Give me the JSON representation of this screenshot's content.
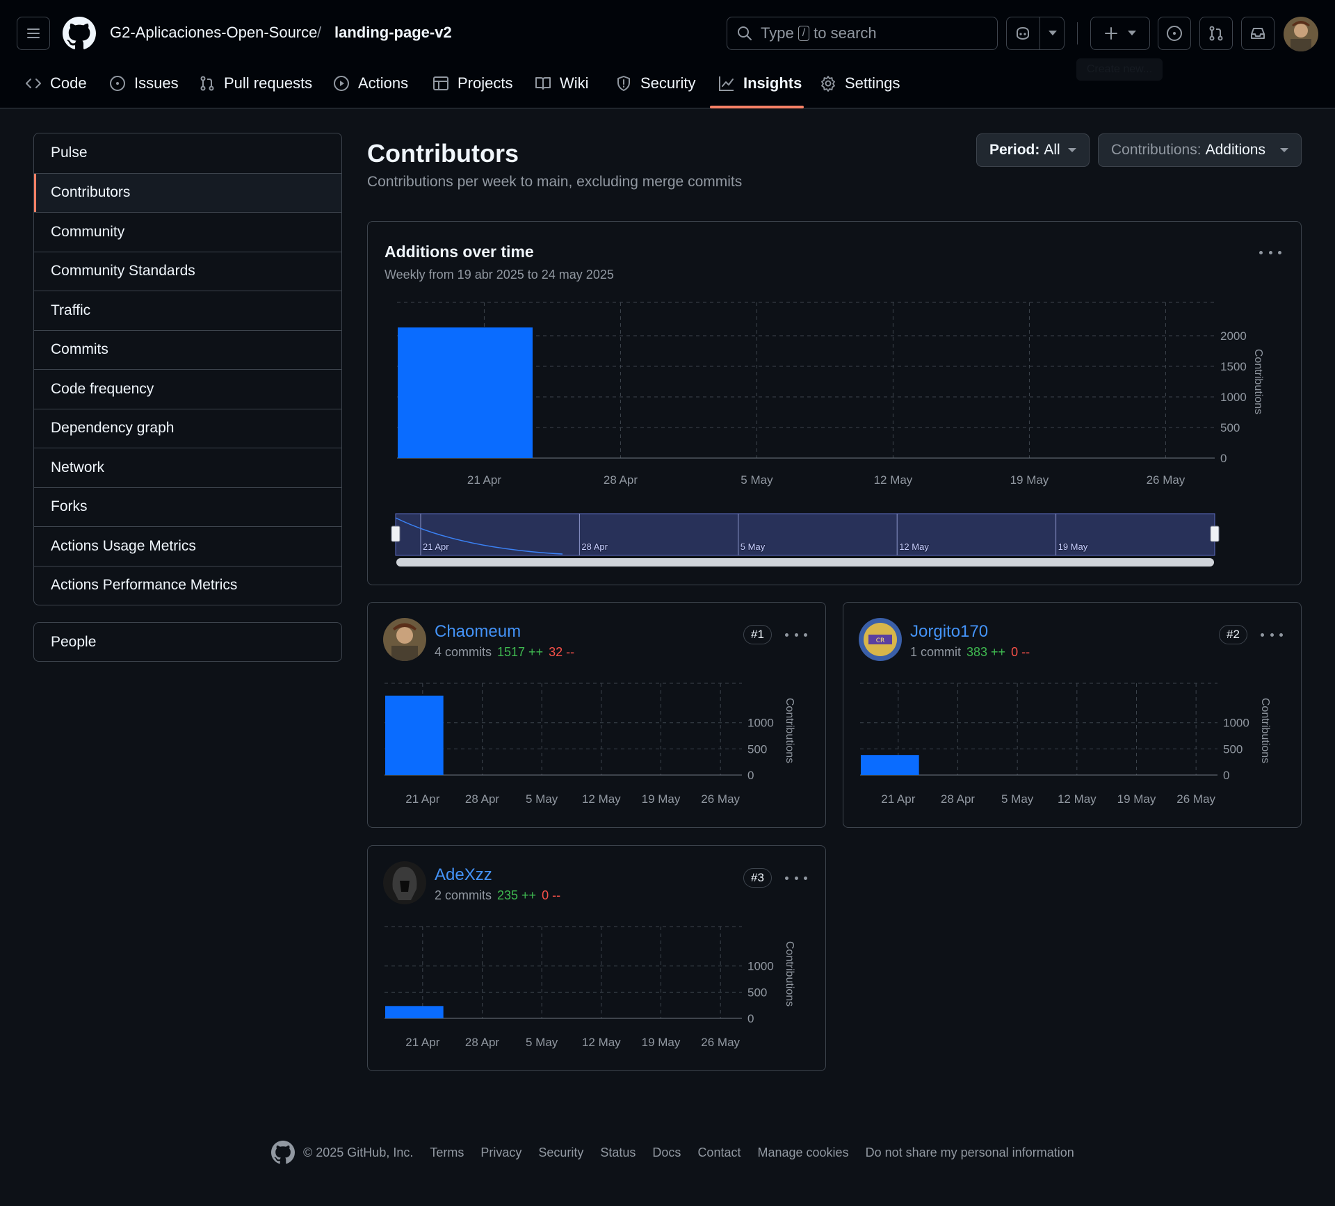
{
  "header": {
    "org": "G2-Aplicaciones-Open-Source",
    "separator": "/",
    "repo": "landing-page-v2",
    "search_prefix": "Type",
    "search_key": "/",
    "search_suffix": "to search",
    "tooltip": "Create new..."
  },
  "tabs": [
    {
      "label": "Code",
      "icon": "code-icon"
    },
    {
      "label": "Issues",
      "icon": "issue-icon"
    },
    {
      "label": "Pull requests",
      "icon": "pull-request-icon"
    },
    {
      "label": "Actions",
      "icon": "play-icon"
    },
    {
      "label": "Projects",
      "icon": "table-icon"
    },
    {
      "label": "Wiki",
      "icon": "book-icon"
    },
    {
      "label": "Security",
      "icon": "shield-icon"
    },
    {
      "label": "Insights",
      "icon": "graph-icon",
      "active": true
    },
    {
      "label": "Settings",
      "icon": "gear-icon"
    }
  ],
  "sidebar": {
    "items": [
      "Pulse",
      "Contributors",
      "Community",
      "Community Standards",
      "Traffic",
      "Commits",
      "Code frequency",
      "Dependency graph",
      "Network",
      "Forks",
      "Actions Usage Metrics",
      "Actions Performance Metrics"
    ],
    "selected": "Contributors",
    "people": "People"
  },
  "page": {
    "title": "Contributors",
    "subtitle": "Contributions per week to main, excluding merge commits",
    "period_label": "Period:",
    "period_value": "All",
    "contrib_label": "Contributions:",
    "contrib_value": "Additions"
  },
  "main_chart": {
    "title": "Additions over time",
    "subtitle": "Weekly from 19 abr 2025 to 24 may 2025"
  },
  "chart_data": [
    {
      "type": "bar",
      "title": "Additions over time",
      "categories": [
        "21 Apr",
        "28 Apr",
        "5 May",
        "12 May",
        "19 May",
        "26 May"
      ],
      "values": [
        2135,
        0,
        0,
        0,
        0,
        0
      ],
      "ylabel": "Contributions",
      "yticks": [
        0,
        500,
        1000,
        1500,
        2000
      ],
      "ylim": [
        0,
        2500
      ],
      "navigator_labels": [
        "21 Apr",
        "28 Apr",
        "5 May",
        "12 May",
        "19 May"
      ],
      "color": "#0a6cff"
    },
    {
      "type": "bar",
      "title": "",
      "categories": [
        "21 Apr",
        "28 Apr",
        "5 May",
        "12 May",
        "19 May",
        "26 May"
      ],
      "values": [
        1517,
        0,
        0,
        0,
        0,
        0
      ],
      "ylabel": "Contributions",
      "yticks": [
        0,
        500,
        1000
      ],
      "ylim": [
        0,
        1700
      ],
      "color": "#0a6cff"
    },
    {
      "type": "bar",
      "title": "",
      "categories": [
        "21 Apr",
        "28 Apr",
        "5 May",
        "12 May",
        "19 May",
        "26 May"
      ],
      "values": [
        383,
        0,
        0,
        0,
        0,
        0
      ],
      "ylabel": "Contributions",
      "yticks": [
        0,
        500,
        1000
      ],
      "ylim": [
        0,
        1700
      ],
      "color": "#0a6cff"
    },
    {
      "type": "bar",
      "title": "",
      "categories": [
        "21 Apr",
        "28 Apr",
        "5 May",
        "12 May",
        "19 May",
        "26 May"
      ],
      "values": [
        235,
        0,
        0,
        0,
        0,
        0
      ],
      "ylabel": "Contributions",
      "yticks": [
        0,
        500,
        1000
      ],
      "ylim": [
        0,
        1700
      ],
      "color": "#0a6cff"
    }
  ],
  "contributors": [
    {
      "name": "Chaomeum",
      "commits": "4 commits",
      "additions": "1517 ++",
      "deletions": "32 --",
      "rank": "#1"
    },
    {
      "name": "Jorgito170",
      "commits": "1 commit",
      "additions": "383 ++",
      "deletions": "0 --",
      "rank": "#2"
    },
    {
      "name": "AdeXzz",
      "commits": "2 commits",
      "additions": "235 ++",
      "deletions": "0 --",
      "rank": "#3"
    }
  ],
  "footer": {
    "copyright": "© 2025 GitHub, Inc.",
    "links": [
      "Terms",
      "Privacy",
      "Security",
      "Status",
      "Docs",
      "Contact",
      "Manage cookies",
      "Do not share my personal information"
    ]
  },
  "colors": {
    "accent": "#f78166",
    "link": "#4493f8",
    "bar": "#0a6cff",
    "add": "#3fb950",
    "del": "#f85149"
  }
}
